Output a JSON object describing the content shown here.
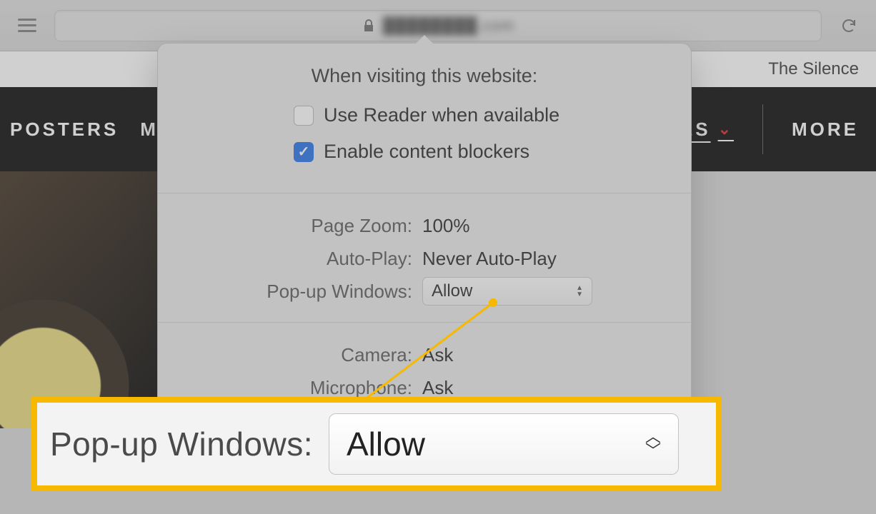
{
  "toolbar": {
    "hamburger_name": "sidebar-menu",
    "reload_name": "reload"
  },
  "header": {
    "right_text": "The Silence"
  },
  "nav": {
    "posters": "POSTERS",
    "m": "M",
    "es": "ES",
    "more": "MORE"
  },
  "popover": {
    "title": "When visiting this website:",
    "reader_label": "Use Reader when available",
    "reader_checked": false,
    "blockers_label": "Enable content blockers",
    "blockers_checked": true,
    "rows1": {
      "zoom_label": "Page Zoom:",
      "zoom_value": "100%",
      "autoplay_label": "Auto-Play:",
      "autoplay_value": "Never Auto-Play",
      "popup_label": "Pop-up Windows:",
      "popup_value": "Allow"
    },
    "rows2": {
      "camera_label": "Camera:",
      "camera_value": "Ask",
      "mic_label": "Microphone:",
      "mic_value": "Ask"
    }
  },
  "callout": {
    "label": "Pop-up Windows:",
    "value": "Allow"
  }
}
